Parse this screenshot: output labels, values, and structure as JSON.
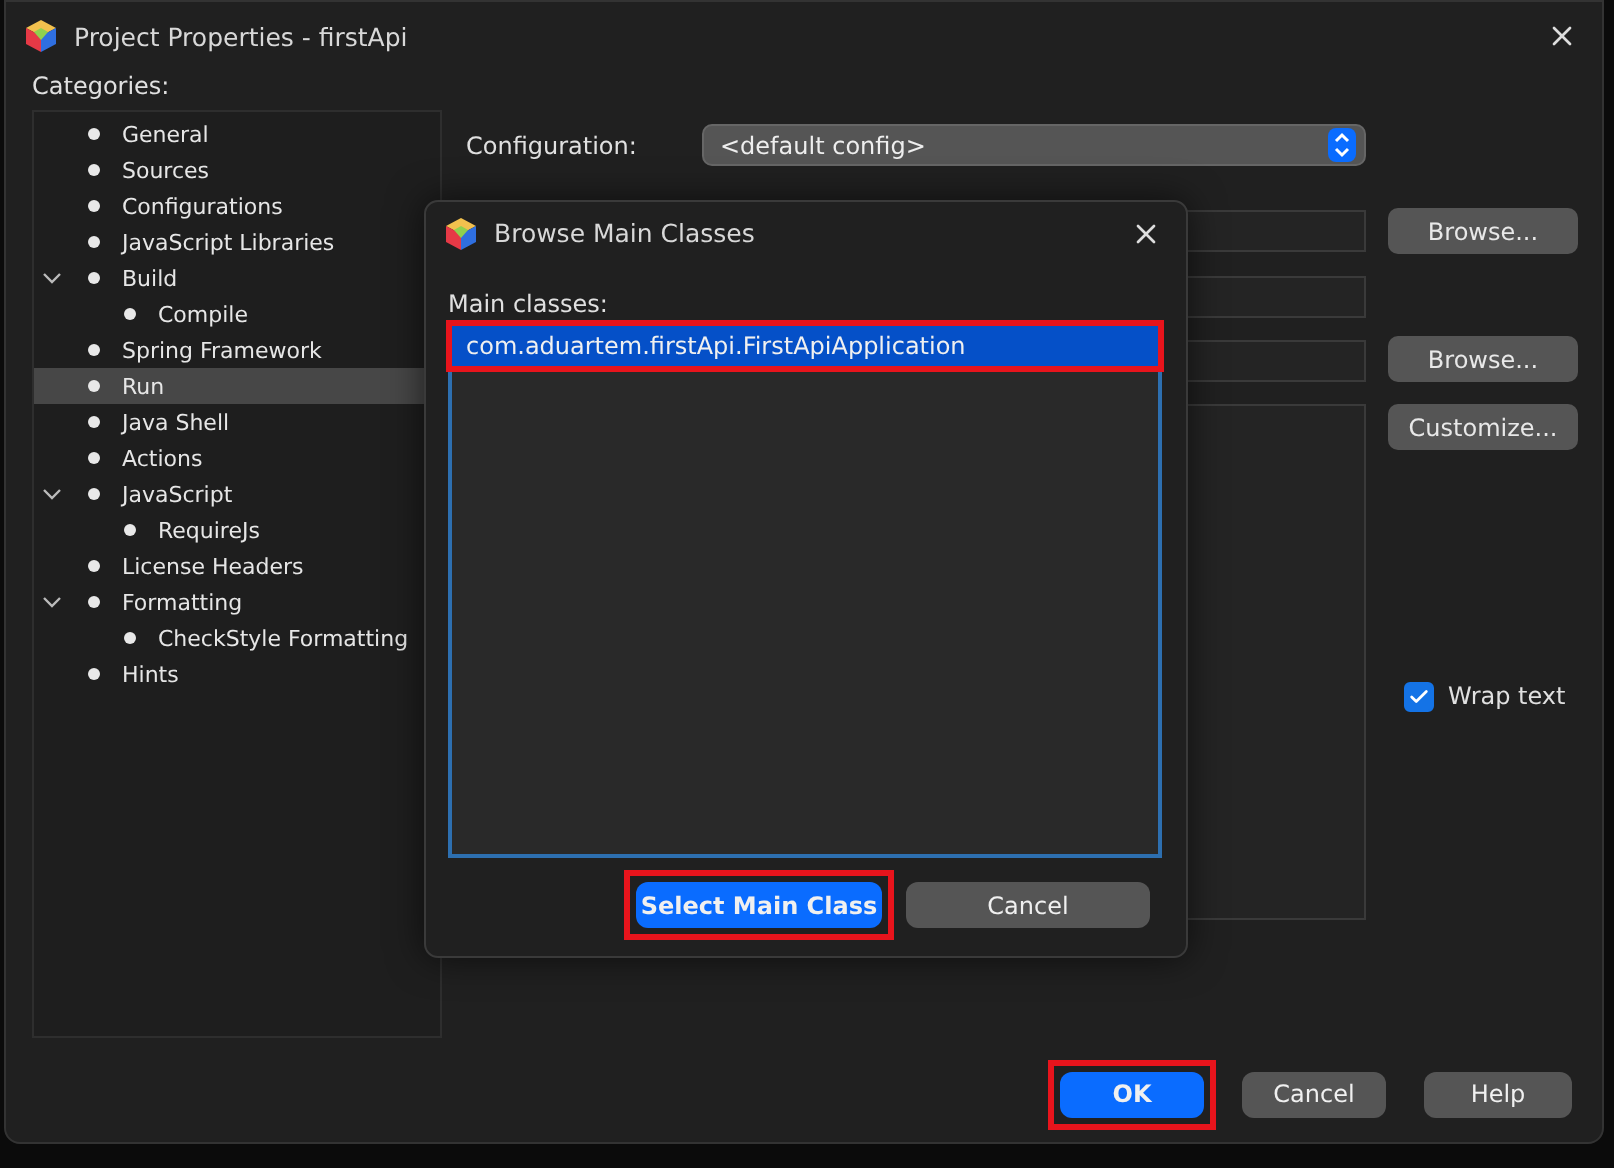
{
  "window": {
    "title": "Project Properties - firstApi"
  },
  "categories": {
    "label": "Categories:",
    "items": [
      {
        "label": "General",
        "selected": false
      },
      {
        "label": "Sources",
        "selected": false
      },
      {
        "label": "Configurations",
        "selected": false
      },
      {
        "label": "JavaScript Libraries",
        "selected": false
      },
      {
        "label": "Build",
        "selected": false,
        "expanded": true,
        "children": [
          {
            "label": "Compile",
            "selected": false
          }
        ]
      },
      {
        "label": "Spring Framework",
        "selected": false
      },
      {
        "label": "Run",
        "selected": true
      },
      {
        "label": "Java Shell",
        "selected": false
      },
      {
        "label": "Actions",
        "selected": false
      },
      {
        "label": "JavaScript",
        "selected": false,
        "expanded": true,
        "children": [
          {
            "label": "RequireJs",
            "selected": false
          }
        ]
      },
      {
        "label": "License Headers",
        "selected": false
      },
      {
        "label": "Formatting",
        "selected": false,
        "expanded": true,
        "children": [
          {
            "label": "CheckStyle Formatting",
            "selected": false
          }
        ]
      },
      {
        "label": "Hints",
        "selected": false
      }
    ]
  },
  "configuration": {
    "label": "Configuration:",
    "value": "<default config>"
  },
  "side_buttons": [
    "Browse...",
    "Browse...",
    "Customize..."
  ],
  "wrap_text": {
    "label": "Wrap text",
    "checked": true
  },
  "buttons": [
    {
      "label": "OK",
      "kind": "primary",
      "highlighted": true
    },
    {
      "label": "Cancel",
      "kind": "secondary",
      "highlighted": false
    },
    {
      "label": "Help",
      "kind": "secondary",
      "highlighted": false
    }
  ],
  "dialog": {
    "title": "Browse Main Classes",
    "list_label": "Main classes:",
    "classes": [
      {
        "name": "com.aduartem.firstApi.FirstApiApplication",
        "selected": true,
        "highlighted": true
      }
    ],
    "buttons": [
      {
        "label": "Select Main Class",
        "kind": "primary",
        "highlighted": true
      },
      {
        "label": "Cancel",
        "kind": "secondary",
        "highlighted": false
      }
    ]
  }
}
